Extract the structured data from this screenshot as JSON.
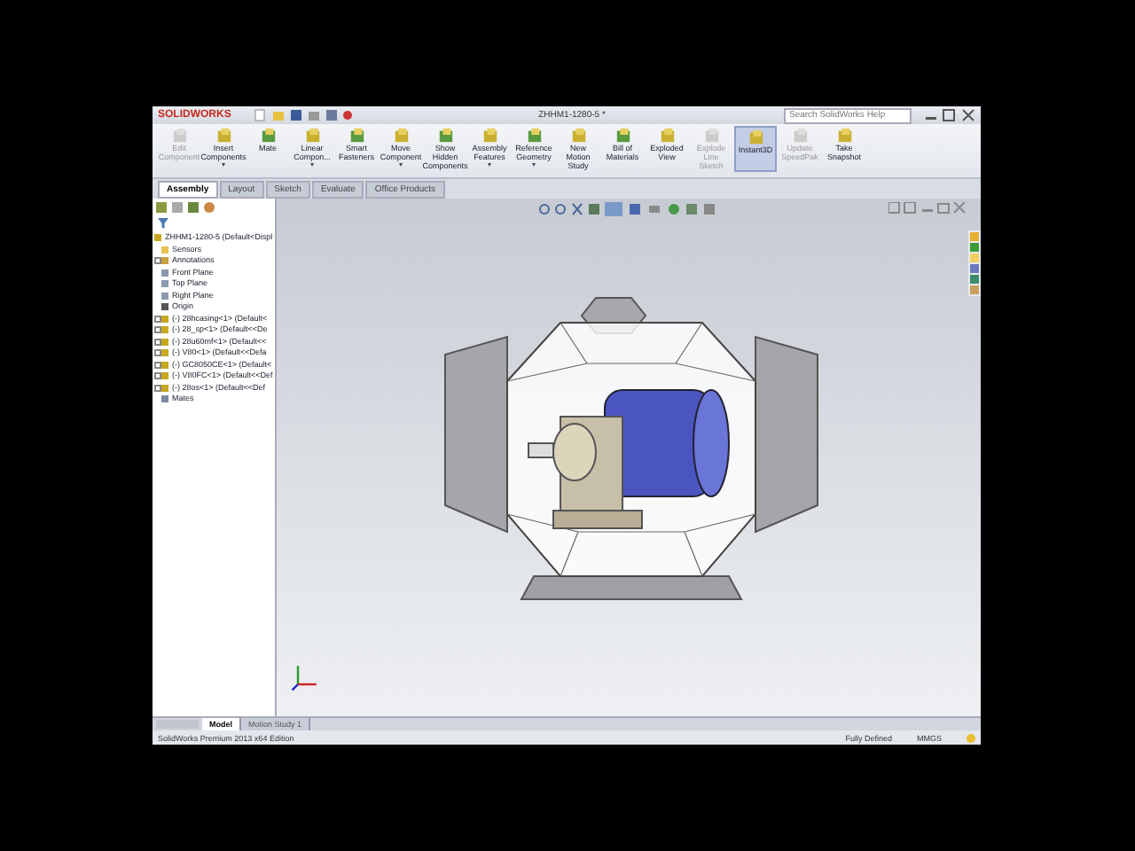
{
  "window": {
    "logo": "SOLIDWORKS",
    "title": "ZHHM1-1280-5 *"
  },
  "search": {
    "placeholder": "Search SolidWorks Help"
  },
  "commands": [
    {
      "label": "Edit Component",
      "disabled": true,
      "selected": false,
      "menu": false
    },
    {
      "label": "Insert Components",
      "disabled": false,
      "selected": false,
      "menu": true
    },
    {
      "label": "Mate",
      "disabled": false,
      "selected": false,
      "menu": false
    },
    {
      "label": "Linear Compon...",
      "disabled": false,
      "selected": false,
      "menu": true
    },
    {
      "label": "Smart Fasteners",
      "disabled": false,
      "selected": false,
      "menu": false
    },
    {
      "label": "Move Component",
      "disabled": false,
      "selected": false,
      "menu": true
    },
    {
      "label": "Show Hidden Components",
      "disabled": false,
      "selected": false,
      "menu": false
    },
    {
      "label": "Assembly Features",
      "disabled": false,
      "selected": false,
      "menu": true
    },
    {
      "label": "Reference Geometry",
      "disabled": false,
      "selected": false,
      "menu": true
    },
    {
      "label": "New Motion Study",
      "disabled": false,
      "selected": false,
      "menu": false
    },
    {
      "label": "Bill of Materials",
      "disabled": false,
      "selected": false,
      "menu": false
    },
    {
      "label": "Exploded View",
      "disabled": false,
      "selected": false,
      "menu": false
    },
    {
      "label": "Explode Line Sketch",
      "disabled": true,
      "selected": false,
      "menu": false
    },
    {
      "label": "Instant3D",
      "disabled": false,
      "selected": true,
      "menu": false
    },
    {
      "label": "Update SpeedPak",
      "disabled": true,
      "selected": false,
      "menu": false
    },
    {
      "label": "Take Snapshot",
      "disabled": false,
      "selected": false,
      "menu": false
    }
  ],
  "tabs": [
    {
      "label": "Assembly",
      "selected": true
    },
    {
      "label": "Layout",
      "selected": false
    },
    {
      "label": "Sketch",
      "selected": false
    },
    {
      "label": "Evaluate",
      "selected": false
    },
    {
      "label": "Office Products",
      "selected": false
    }
  ],
  "tree": {
    "label": "ZHHM1-1280-5  (Default<Displ",
    "children": [
      {
        "label": "Sensors",
        "kind": "folder",
        "expandable": false
      },
      {
        "label": "Annotations",
        "kind": "annotation",
        "expandable": true
      },
      {
        "label": "Front Plane",
        "kind": "plane",
        "expandable": false
      },
      {
        "label": "Top Plane",
        "kind": "plane",
        "expandable": false
      },
      {
        "label": "Right Plane",
        "kind": "plane",
        "expandable": false
      },
      {
        "label": "Origin",
        "kind": "origin",
        "expandable": false
      },
      {
        "label": "(-) 28hcasing<1> (Default<",
        "kind": "part",
        "expandable": true
      },
      {
        "label": "(-) 28_sp<1> (Default<<De",
        "kind": "part",
        "expandable": true
      },
      {
        "label": "(-) 28u60mf<1> (Default<<",
        "kind": "part",
        "expandable": true
      },
      {
        "label": "(-) V80<1> (Default<<Defa",
        "kind": "part",
        "expandable": true
      },
      {
        "label": "(-) GC8050CE<1> (Default<",
        "kind": "part",
        "expandable": true
      },
      {
        "label": "(-) V80FC<1> (Default<<Def",
        "kind": "part",
        "expandable": true
      },
      {
        "label": "(-) 28os<1> (Default<<Def",
        "kind": "part",
        "expandable": true
      },
      {
        "label": "Mates",
        "kind": "mates",
        "expandable": false
      }
    ]
  },
  "bottom_tabs": [
    {
      "label": "Model",
      "selected": true
    },
    {
      "label": "Motion Study 1",
      "selected": false
    }
  ],
  "status_bar": {
    "edition": "SolidWorks Premium 2013 x64 Edition",
    "state": "Fully Defined",
    "units": "MMGS"
  }
}
